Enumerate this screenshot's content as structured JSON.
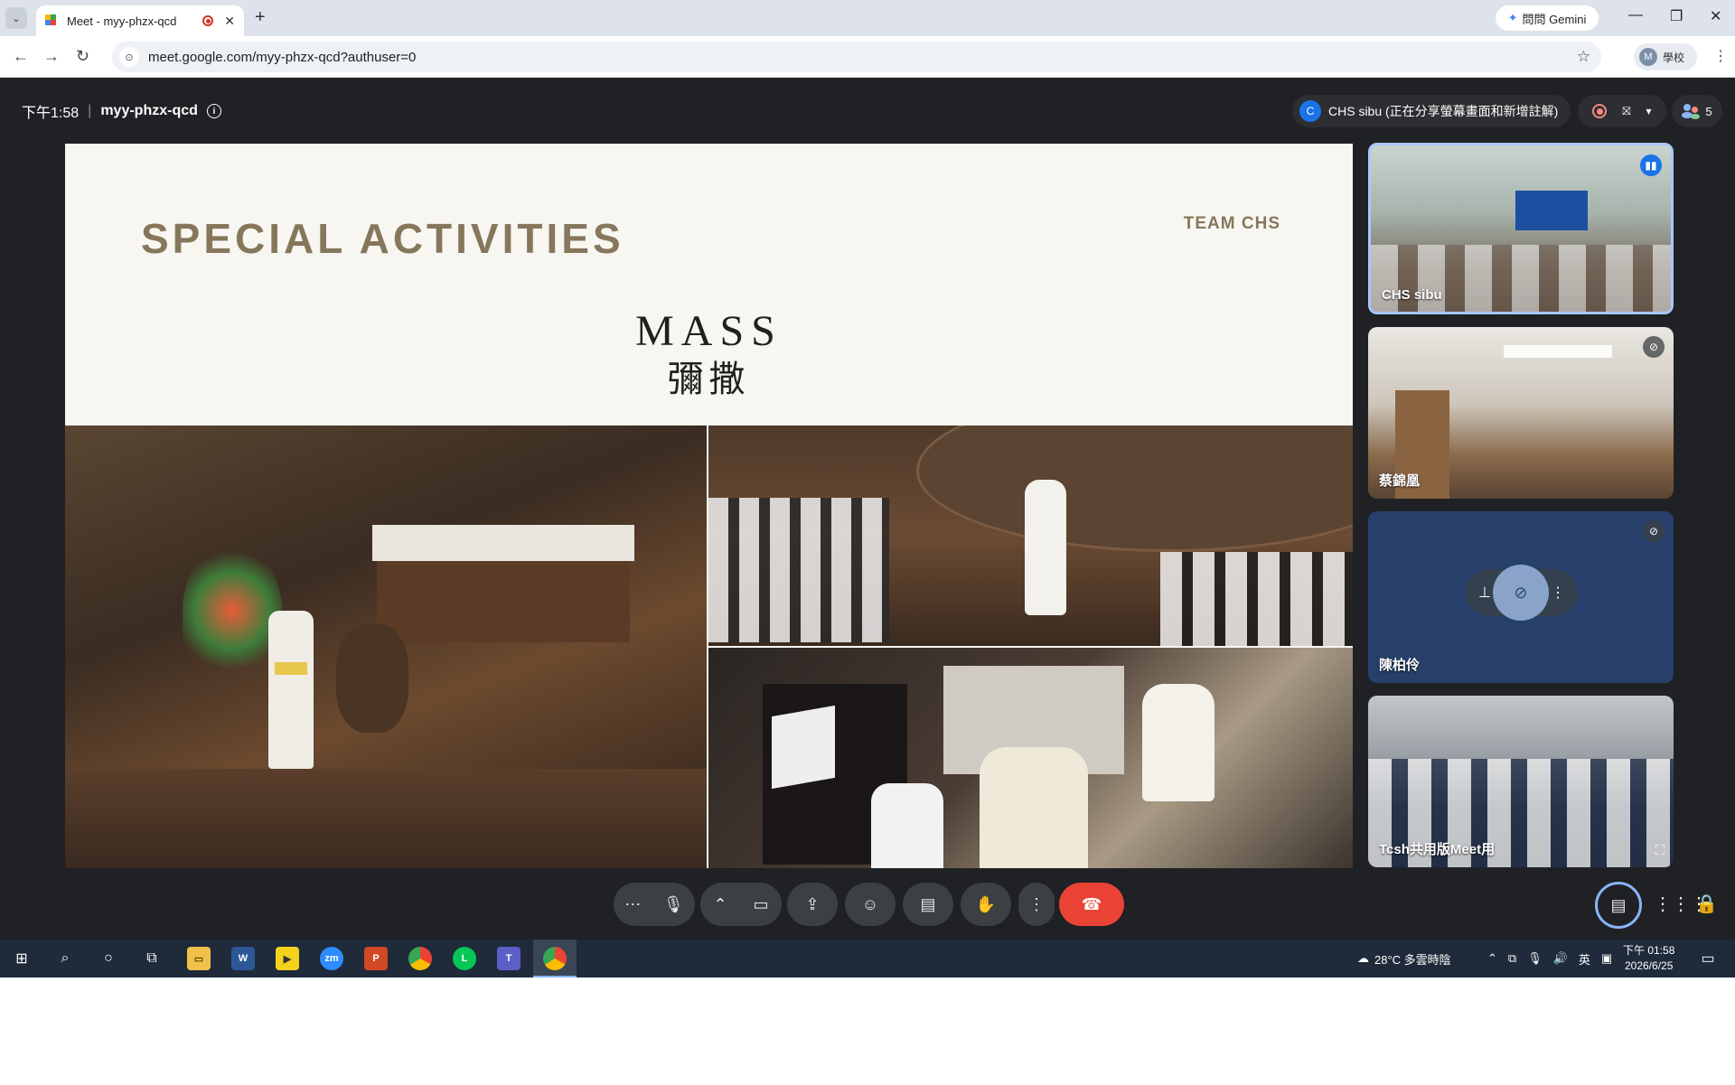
{
  "browser": {
    "tab_title": "Meet - myy-phzx-qcd",
    "new_tab": "+",
    "gemini_label": "問問 Gemini",
    "url": "meet.google.com/myy-phzx-qcd?authuser=0",
    "profile_initial": "M",
    "profile_label": "學校"
  },
  "meet": {
    "time": "下午1:58",
    "separator": "|",
    "meeting_code": "myy-phzx-qcd",
    "presenter_initial": "C",
    "presenter_text": "CHS sibu (正在分享螢幕畫面和新增註解)",
    "participant_count": "5"
  },
  "slide": {
    "title": "SPECIAL ACTIVITIES",
    "team": "TEAM CHS",
    "heading": "MASS",
    "heading_zh": "彌撒"
  },
  "participants": [
    {
      "name": "CHS sibu"
    },
    {
      "name": "蔡錦凰"
    },
    {
      "name": "陳柏伶"
    },
    {
      "name": "Tcsh共用版Meet用"
    }
  ],
  "taskbar": {
    "weather": "28°C 多雲時陰",
    "ime": "英",
    "clock_time": "下午 01:58",
    "clock_date": "2026/6/25"
  }
}
